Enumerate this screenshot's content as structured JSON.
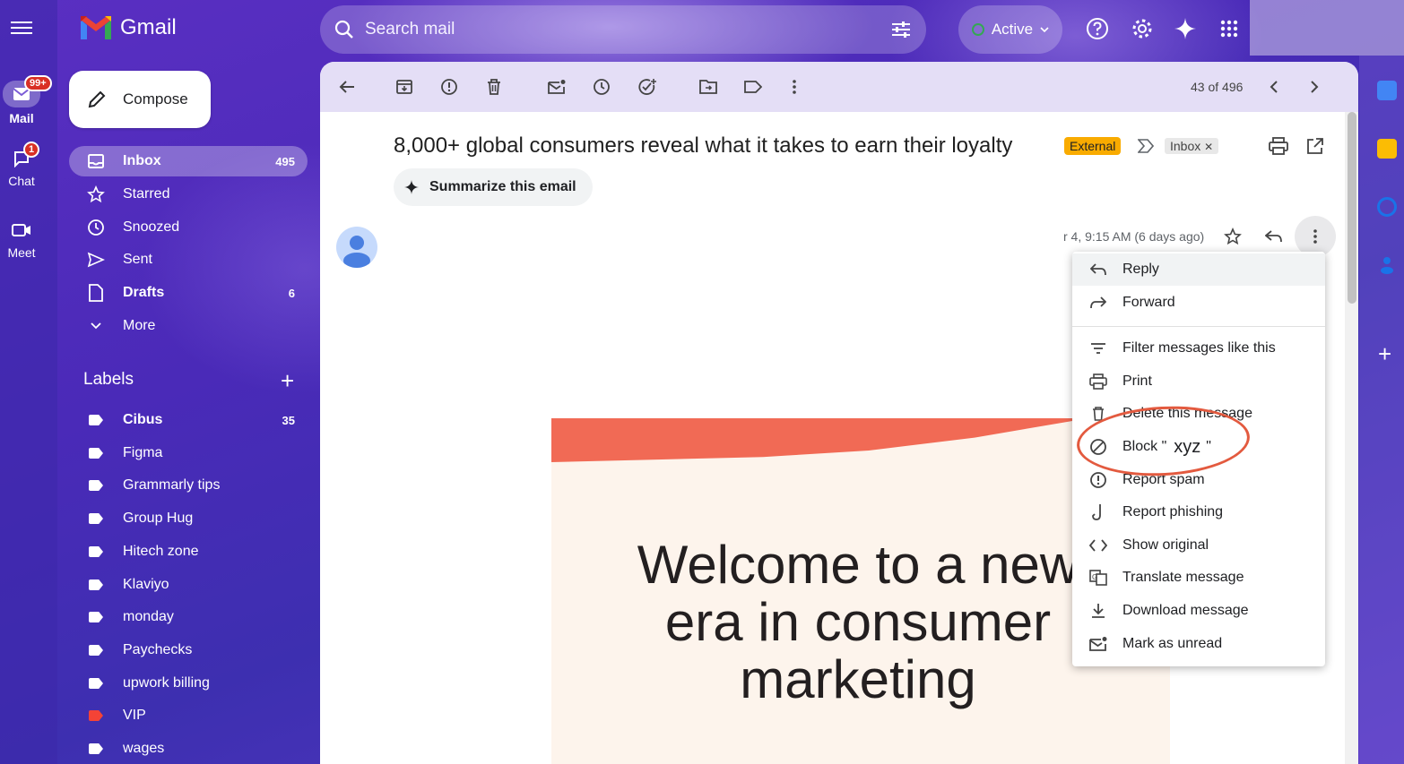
{
  "app": {
    "name": "Gmail"
  },
  "rail": {
    "items": [
      {
        "label": "Mail",
        "badge": "99+"
      },
      {
        "label": "Chat",
        "badge": "1"
      },
      {
        "label": "Meet"
      }
    ]
  },
  "search": {
    "placeholder": "Search mail"
  },
  "status": {
    "label": "Active"
  },
  "nav": {
    "compose": "Compose",
    "items": [
      {
        "label": "Inbox",
        "count": "495"
      },
      {
        "label": "Starred",
        "count": ""
      },
      {
        "label": "Snoozed",
        "count": ""
      },
      {
        "label": "Sent",
        "count": ""
      },
      {
        "label": "Drafts",
        "count": "6"
      },
      {
        "label": "More",
        "count": ""
      }
    ],
    "labels_title": "Labels",
    "labels": [
      {
        "name": "Cibus",
        "count": "35",
        "color": "#ffffff"
      },
      {
        "name": "Figma",
        "count": "",
        "color": "#ffffff"
      },
      {
        "name": "Grammarly tips",
        "count": "",
        "color": "#ffffff"
      },
      {
        "name": "Group Hug",
        "count": "",
        "color": "#ffffff"
      },
      {
        "name": "Hitech zone",
        "count": "",
        "color": "#ffffff"
      },
      {
        "name": "Klaviyo",
        "count": "",
        "color": "#ffffff"
      },
      {
        "name": "monday",
        "count": "",
        "color": "#ffffff"
      },
      {
        "name": "Paychecks",
        "count": "",
        "color": "#ffffff"
      },
      {
        "name": "upwork billing",
        "count": "",
        "color": "#ffffff"
      },
      {
        "name": "VIP",
        "count": "",
        "color": "#f44336"
      },
      {
        "name": "wages",
        "count": "",
        "color": "#ffffff"
      }
    ]
  },
  "toolbar": {
    "pagination": "43 of 496"
  },
  "email": {
    "subject": "8,000+ global consumers reveal what it takes to earn their loyalty",
    "external_badge": "External",
    "inbox_chip": "Inbox",
    "summarize": "Summarize this email",
    "date": "r 4, 9:15 AM (6 days ago)",
    "headline": "Welcome to a new era in consumer marketing"
  },
  "menu": {
    "items": [
      {
        "label": "Reply",
        "icon": "reply-icon"
      },
      {
        "label": "Forward",
        "icon": "forward-icon"
      },
      {
        "label": "Filter messages like this",
        "icon": "filter-icon"
      },
      {
        "label": "Print",
        "icon": "print-icon"
      },
      {
        "label": "Delete this message",
        "icon": "trash-icon"
      },
      {
        "label_prefix": "Block \"",
        "label_name": "xyz",
        "label_suffix": "\"",
        "icon": "block-icon"
      },
      {
        "label": "Report spam",
        "icon": "spam-icon"
      },
      {
        "label": "Report phishing",
        "icon": "phishing-icon"
      },
      {
        "label": "Show original",
        "icon": "code-icon"
      },
      {
        "label": "Translate message",
        "icon": "translate-icon"
      },
      {
        "label": "Download message",
        "icon": "download-icon"
      },
      {
        "label": "Mark as unread",
        "icon": "mark-unread-icon"
      }
    ]
  },
  "colors": {
    "accent": "#5a2fc2",
    "external": "#f9ab00",
    "banner_red": "#f16a55",
    "annotation": "#e35a3f"
  }
}
